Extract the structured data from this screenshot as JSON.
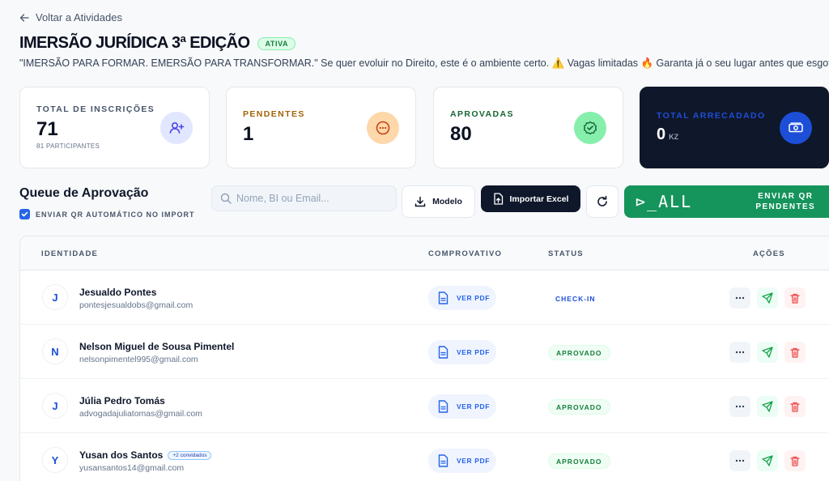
{
  "nav": {
    "back_label": "Voltar a Atividades"
  },
  "event": {
    "title": "IMERSÃO JURÍDICA 3ª EDIÇÃO",
    "status": "ATIVA",
    "description": "\"IMERSÃO PARA FORMAR. EMERSÃO PARA TRANSFORMAR.\" Se quer evoluir no Direito, este é o ambiente certo. ⚠️ Vagas limitadas 🔥 Garanta já o seu lugar antes que esgote!"
  },
  "stats": {
    "total": {
      "label": "TOTAL DE INSCRIÇÕES",
      "value": "71",
      "sub": "81 PARTICIPANTES",
      "icon": "user-plus-icon"
    },
    "pending": {
      "label": "PENDENTES",
      "value": "1",
      "icon": "dots-circle-icon"
    },
    "approved": {
      "label": "APROVADAS",
      "value": "80",
      "icon": "badge-check-icon"
    },
    "revenue": {
      "label": "TOTAL ARRECADADO",
      "value": "0",
      "currency": "KZ",
      "icon": "banknote-icon"
    }
  },
  "colors": {
    "pending_accent": "#a16207",
    "approved_accent": "#166534",
    "revenue_accent": "#2563eb",
    "green": "#15945c"
  },
  "queue": {
    "title": "Queue de Aprovação",
    "auto_qr_label": "ENVIAR QR AUTOMÁTICO NO IMPORT",
    "auto_qr_checked": true,
    "search_placeholder": "Nome, BI ou Email...",
    "modelo_label": "Modelo",
    "import_label": "Importar Excel",
    "send_all_glyph": "⊳_ALL",
    "send_qr_line1": "ENVIAR QR",
    "send_qr_line2": "PENDENTES"
  },
  "table": {
    "headers": {
      "identity": "IDENTIDADE",
      "receipt": "COMPROVATIVO",
      "status": "STATUS",
      "actions": "AÇÕES"
    },
    "pdf_label": "VER PDF",
    "rows": [
      {
        "initial": "J",
        "name": "Jesualdo Pontes",
        "email": "pontesjesualdobs@gmail.com",
        "status": "CHECK-IN",
        "guests": ""
      },
      {
        "initial": "N",
        "name": "Nelson Miguel de Sousa Pimentel",
        "email": "nelsonpimentel995@gmail.com",
        "status": "APROVADO",
        "guests": ""
      },
      {
        "initial": "J",
        "name": "Júlia Pedro Tomás",
        "email": "advogadajuliatomas@gmail.com",
        "status": "APROVADO",
        "guests": ""
      },
      {
        "initial": "Y",
        "name": "Yusan dos Santos",
        "email": "yusansantos14@gmail.com",
        "status": "APROVADO",
        "guests": "+2 convidados"
      }
    ]
  }
}
